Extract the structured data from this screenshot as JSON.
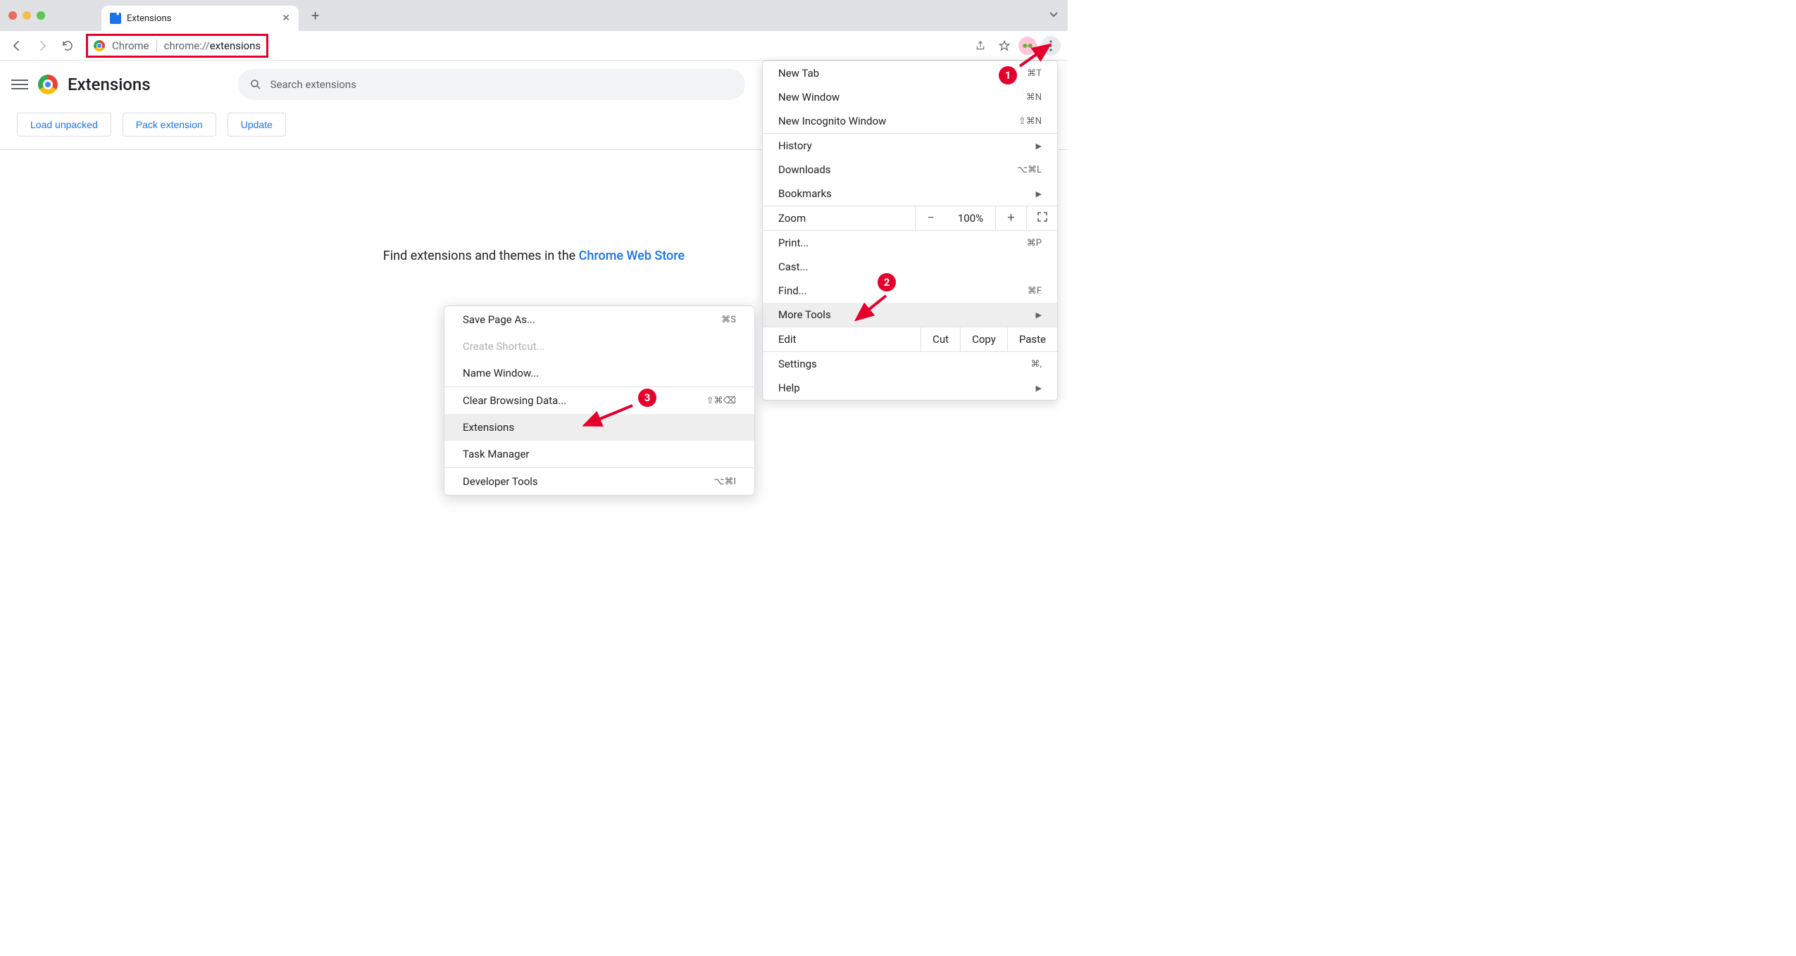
{
  "window": {
    "tab": {
      "title": "Extensions"
    }
  },
  "toolbar": {
    "chip": "Chrome",
    "url_prefix": "chrome://",
    "url_bold": "extensions"
  },
  "page": {
    "title": "Extensions",
    "search_placeholder": "Search extensions",
    "buttons": {
      "load_unpacked": "Load unpacked",
      "pack_extension": "Pack extension",
      "update": "Update"
    },
    "message_prefix": "Find extensions and themes in the ",
    "message_link": "Chrome Web Store"
  },
  "menu": {
    "new_tab": "New Tab",
    "new_tab_sc": "⌘T",
    "new_window": "New Window",
    "new_window_sc": "⌘N",
    "new_incognito": "New Incognito Window",
    "new_incognito_sc": "⇧⌘N",
    "history": "History",
    "downloads": "Downloads",
    "downloads_sc": "⌥⌘L",
    "bookmarks": "Bookmarks",
    "zoom": "Zoom",
    "zoom_pct": "100%",
    "print": "Print...",
    "print_sc": "⌘P",
    "cast": "Cast...",
    "find": "Find...",
    "find_sc": "⌘F",
    "more_tools": "More Tools",
    "edit": "Edit",
    "cut": "Cut",
    "copy": "Copy",
    "paste": "Paste",
    "settings": "Settings",
    "settings_sc": "⌘,",
    "help": "Help"
  },
  "submenu": {
    "save_page": "Save Page As...",
    "save_page_sc": "⌘S",
    "create_shortcut": "Create Shortcut...",
    "name_window": "Name Window...",
    "clear_browsing": "Clear Browsing Data...",
    "clear_browsing_sc": "⇧⌘⌫",
    "extensions": "Extensions",
    "task_manager": "Task Manager",
    "dev_tools": "Developer Tools",
    "dev_tools_sc": "⌥⌘I"
  },
  "annotations": {
    "b1": "1",
    "b2": "2",
    "b3": "3"
  }
}
